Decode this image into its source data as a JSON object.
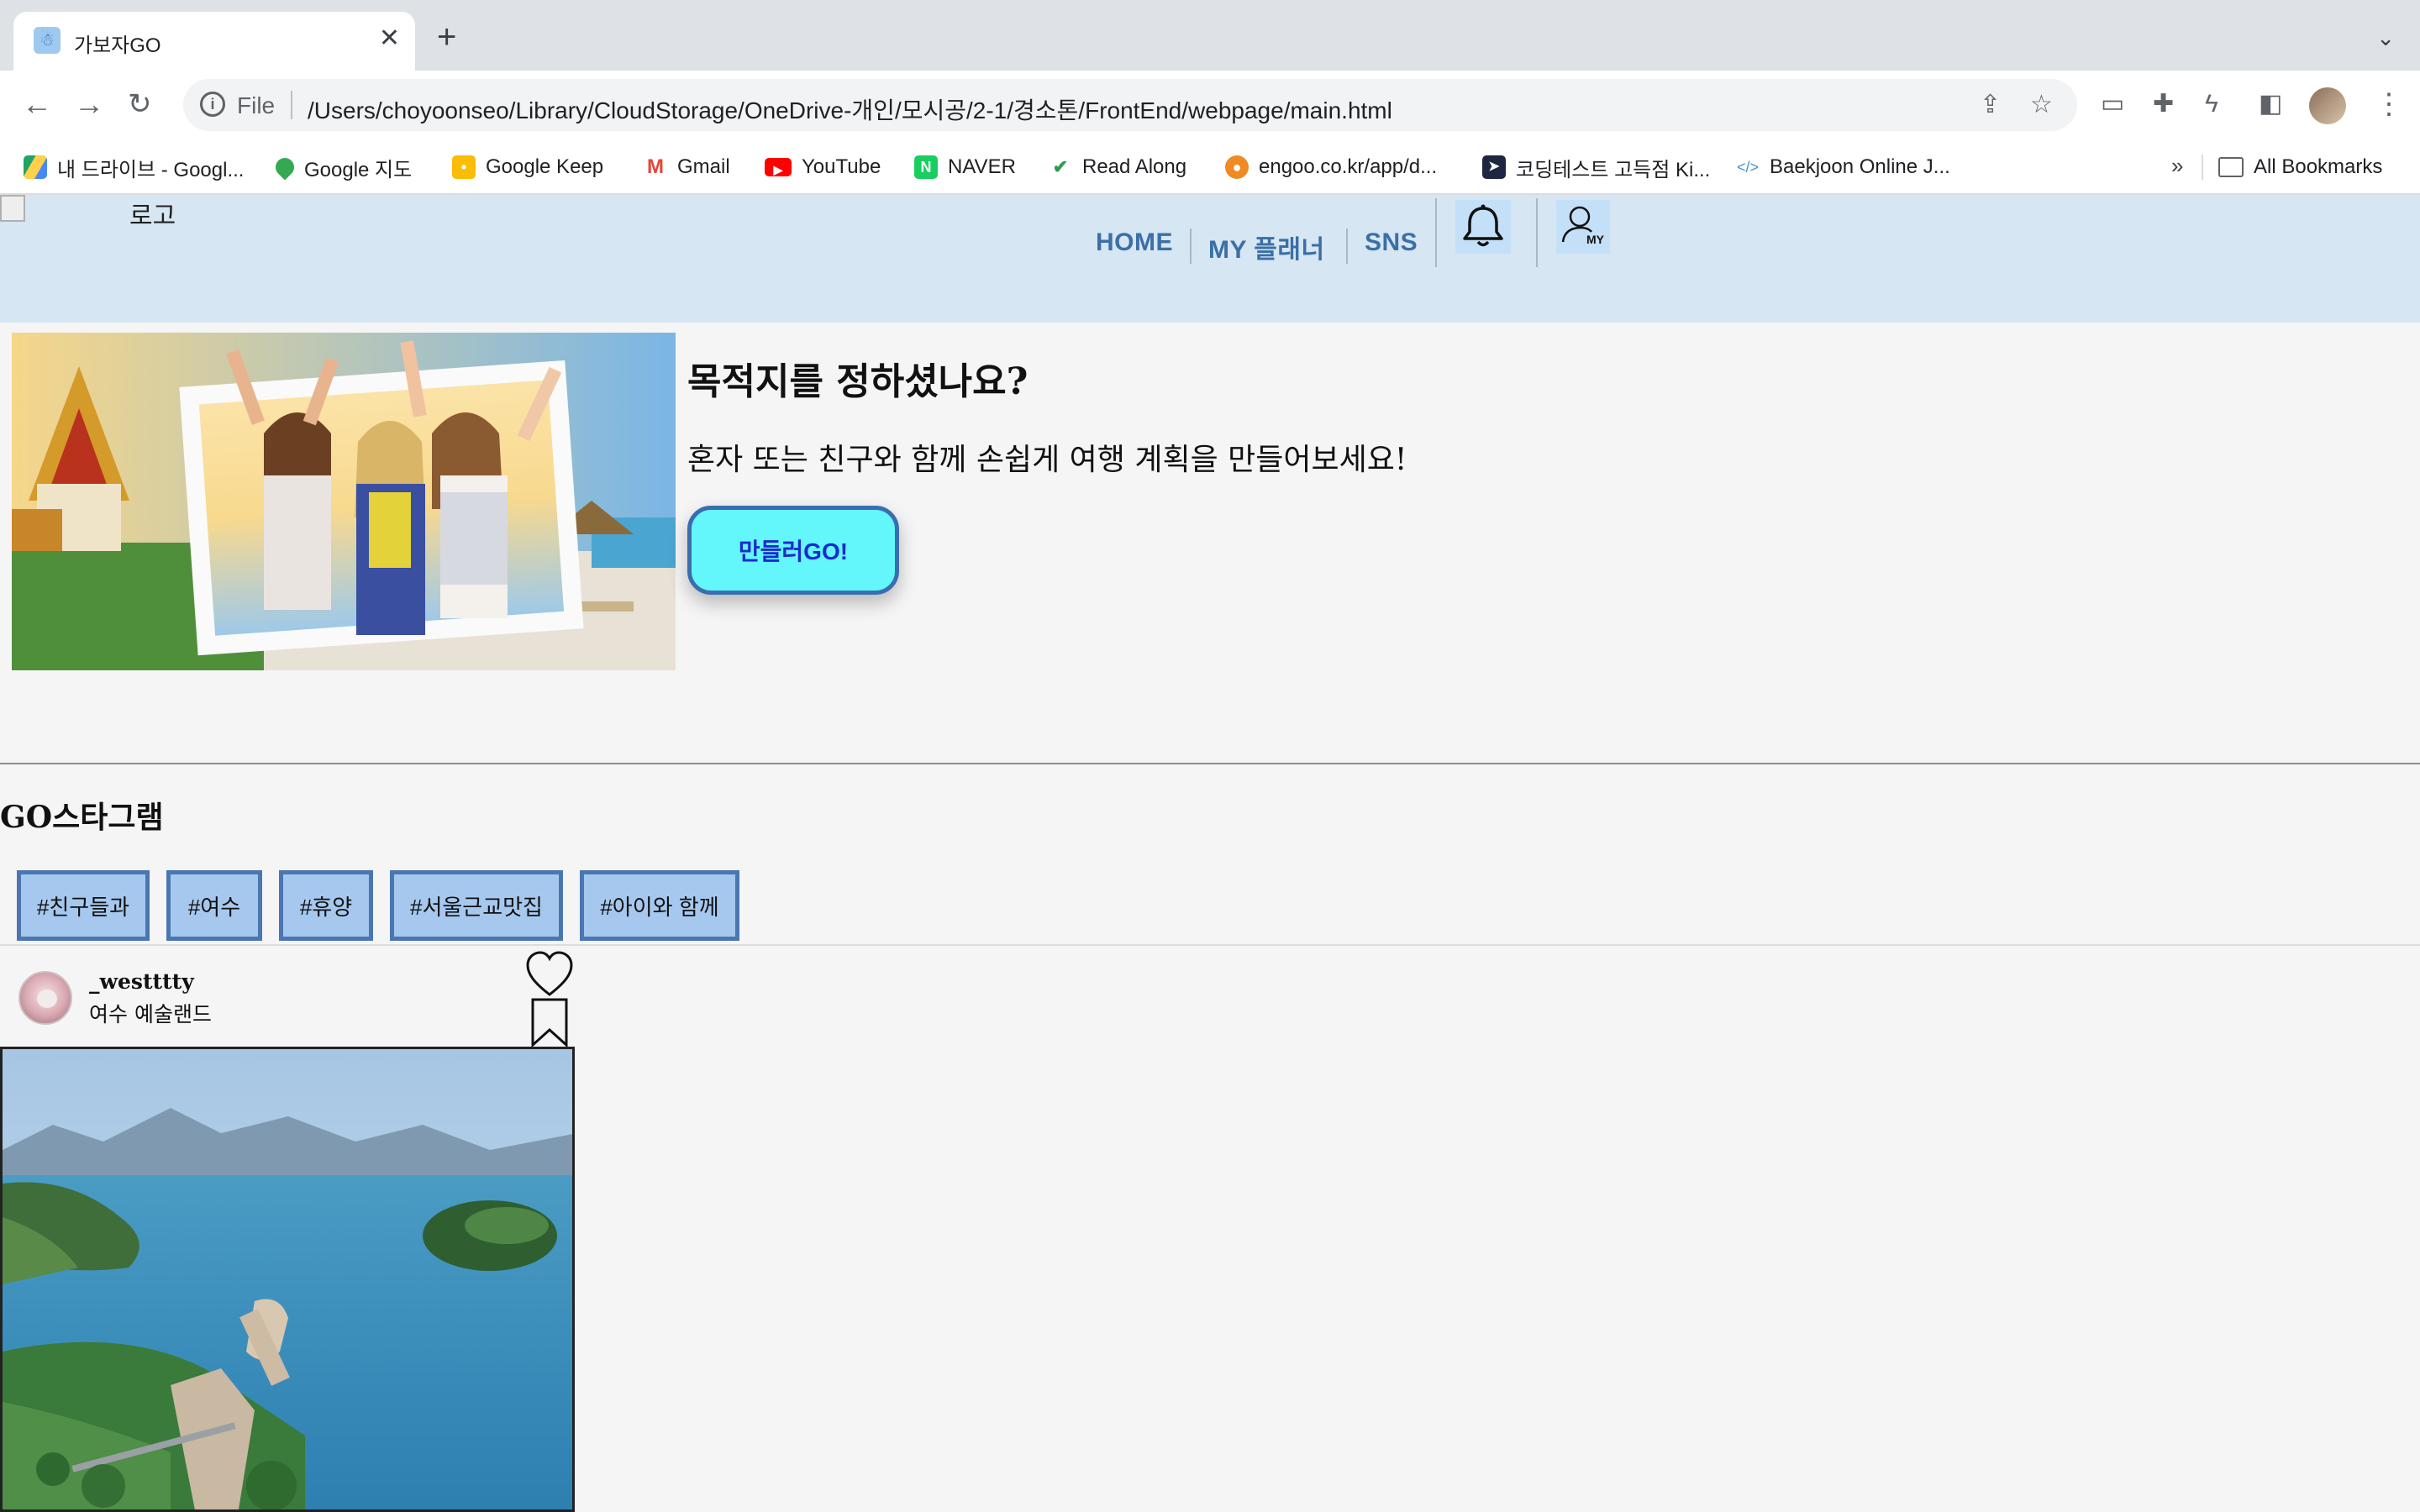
{
  "browser": {
    "tab_title": "가보자GO",
    "file_label": "File",
    "url": "/Users/choyoonseo/Library/CloudStorage/OneDrive-개인/모시공/2-1/경소톤/FrontEnd/webpage/main.html",
    "bookmarks": [
      {
        "label": "내 드라이브 - Googl...",
        "icon": "google-drive-icon"
      },
      {
        "label": "Google 지도",
        "icon": "google-maps-icon"
      },
      {
        "label": "Google Keep",
        "icon": "google-keep-icon"
      },
      {
        "label": "Gmail",
        "icon": "gmail-icon"
      },
      {
        "label": "YouTube",
        "icon": "youtube-icon"
      },
      {
        "label": "NAVER",
        "icon": "naver-icon"
      },
      {
        "label": "Read Along",
        "icon": "read-along-icon"
      },
      {
        "label": "engoo.co.kr/app/d...",
        "icon": "engoo-icon"
      },
      {
        "label": "코딩테스트 고득점 Ki...",
        "icon": "programmers-icon"
      },
      {
        "label": "Baekjoon Online J...",
        "icon": "code-icon"
      }
    ],
    "more_bookmarks": "»",
    "all_bookmarks": "All Bookmarks"
  },
  "header": {
    "logo_alt": "로고",
    "nav": [
      "HOME",
      "MY 플래너",
      "SNS"
    ],
    "my_label": "MY"
  },
  "hero": {
    "title": "목적지를 정하셨나요?",
    "subtitle": "혼자 또는 친구와 함께 손쉽게 여행 계획을 만들어보세요!",
    "cta": "만들러GO!"
  },
  "feed": {
    "section_title": "GO스타그램",
    "tags": [
      "#친구들과",
      "#여수",
      "#휴양",
      "#서울근교맛집",
      "#아이와 함께"
    ],
    "post": {
      "username": "_westttty",
      "location": "여수 예술랜드"
    }
  }
}
